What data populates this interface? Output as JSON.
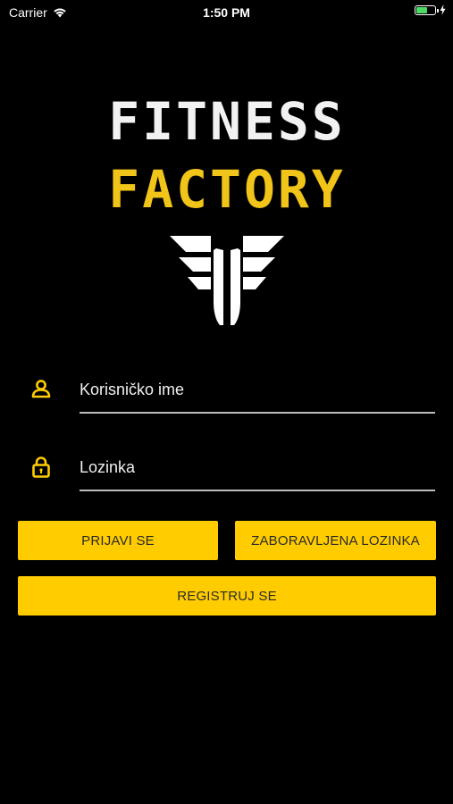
{
  "status_bar": {
    "carrier": "Carrier",
    "time": "1:50 PM",
    "battery_level": 0.65
  },
  "logo": {
    "line1": "FITNESS",
    "line2": "FACTORY",
    "colors": {
      "line1": "#f2f2f2",
      "line2": "#f0c419"
    }
  },
  "form": {
    "username": {
      "placeholder": "Korisničko ime",
      "value": "",
      "icon": "user-icon"
    },
    "password": {
      "placeholder": "Lozinka",
      "value": "",
      "icon": "lock-icon"
    }
  },
  "buttons": {
    "login": "PRIJAVI SE",
    "forgot_password": "ZABORAVLJENA LOZINKA",
    "register": "REGISTRUJ SE"
  },
  "colors": {
    "background": "#000000",
    "accent": "#ffcc00",
    "button_text": "#2b2b2b"
  }
}
